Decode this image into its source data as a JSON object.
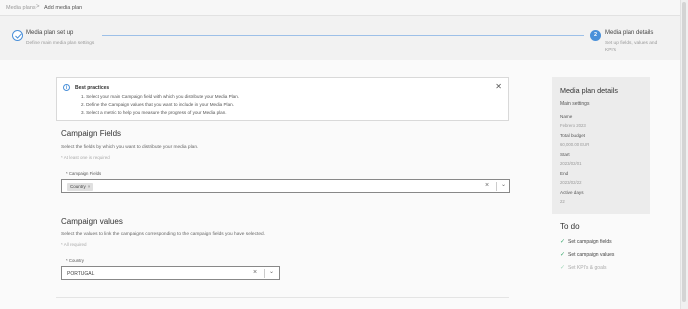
{
  "breadcrumb": {
    "items": [
      "Media plans",
      "Add media plan"
    ],
    "separator": ">"
  },
  "stepper": {
    "steps": [
      {
        "title": "Media plan set up",
        "subtitle": "Define main media plan settings",
        "status": "completed"
      },
      {
        "number": "2",
        "title": "Media plan details",
        "subtitle_lines": [
          "Set up fields, values and",
          "KPI's"
        ],
        "status": "active"
      }
    ]
  },
  "best_practices": {
    "title": "Best practices",
    "lines": [
      "1. Select your main Campaign field with which you distribute your Media Plan.",
      "2. Define the Campaign values that you want to include in your Media Plan.",
      "3. Select a metric to help you measure the progress of your Media plan."
    ]
  },
  "campaign_fields": {
    "title": "Campaign Fields",
    "description": "Select the fields by which you want to distribute your media plan.",
    "hint": "* At least one is required",
    "field_label": "* Campaign Fields",
    "chips": [
      {
        "label": "Country",
        "remove": "×"
      }
    ],
    "clear": "×",
    "caret": "⌄"
  },
  "campaign_values": {
    "title": "Campaign values",
    "description": "Select the values to link the campaigns corresponding to the campaign fields you have selected.",
    "hint": "* All required",
    "field_label": "* Country",
    "value": "PORTUGAL",
    "clear": "×",
    "caret": "⌄"
  },
  "details": {
    "title": "Media plan details",
    "subtitle": "Main settings",
    "fields": [
      {
        "label": "Name",
        "value": "Febrero 2023"
      },
      {
        "label": "Total budget",
        "value": "60,000.00 EUR"
      },
      {
        "label": "Start",
        "value": "2023/02/01"
      },
      {
        "label": "End",
        "value": "2023/02/22"
      },
      {
        "label": "Active days",
        "value": "22"
      }
    ]
  },
  "todo": {
    "title": "To do",
    "items": [
      {
        "label": "Set campaign fields",
        "done": true,
        "check": "✓"
      },
      {
        "label": "Set campaign values",
        "done": true,
        "check": "✓"
      },
      {
        "label": "Set KPI's & goals",
        "done": false,
        "check": "✓"
      }
    ]
  },
  "colors": {
    "accent": "#4a90d9",
    "success": "#3aa76d",
    "panel": "#ececec"
  }
}
